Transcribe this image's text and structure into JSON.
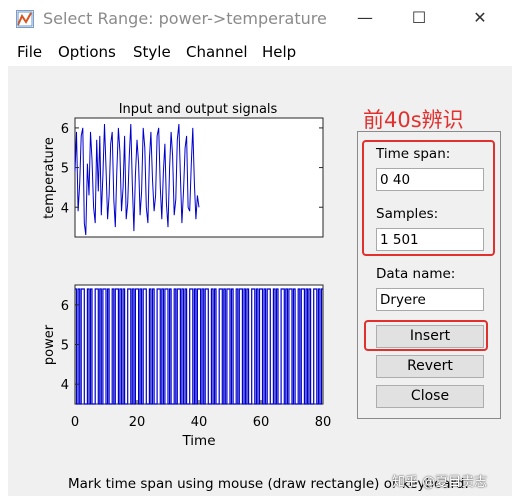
{
  "window": {
    "title": "Select Range: power->temperature",
    "minimize_glyph": "—",
    "maximize_glyph": "☐",
    "close_glyph": "✕"
  },
  "menu": [
    "File",
    "Options",
    "Style",
    "Channel",
    "Help"
  ],
  "plot": {
    "title": "Input and output signals",
    "top_ylabel": "temperature",
    "bottom_ylabel": "power",
    "xlabel": "Time",
    "top_yticks": [
      "6",
      "5",
      "4"
    ],
    "bottom_yticks": [
      "6",
      "5",
      "4"
    ],
    "xticks": [
      "0",
      "20",
      "40",
      "60",
      "80"
    ],
    "line_color": "#0000cd"
  },
  "chart_data": [
    {
      "type": "line",
      "title": "Input and output signals",
      "xlabel": "",
      "ylabel": "temperature",
      "xlim": [
        0,
        80
      ],
      "ylim": [
        3.25,
        6.25
      ],
      "series": [
        {
          "values": [
            4.9,
            5.9,
            3.9,
            4.6,
            5.8,
            6.0,
            3.6,
            3.3,
            5.1,
            4.3,
            5.9,
            5.2,
            4.0,
            3.6,
            5.7,
            4.4,
            5.8,
            3.8,
            4.8,
            6.1,
            5.0,
            3.7,
            4.3,
            5.6,
            5.9,
            4.2,
            3.5,
            4.9,
            6.0,
            5.4,
            3.9,
            4.5,
            5.8,
            3.7,
            4.1,
            5.3,
            6.1,
            4.6,
            3.4,
            4.8,
            5.7,
            5.1,
            3.8,
            4.4,
            6.0,
            5.5,
            4.0,
            3.6,
            5.2,
            5.9,
            4.7,
            3.9,
            4.3,
            5.8,
            6.0,
            4.5,
            3.7,
            4.9,
            5.6,
            4.1,
            3.5,
            5.0,
            5.9,
            5.3,
            3.8,
            4.2,
            5.7,
            6.1,
            4.8,
            3.6,
            4.4,
            5.5,
            5.8,
            4.0,
            3.9,
            5.1,
            6.0,
            4.6,
            3.7,
            4.3,
            4.0
          ]
        }
      ]
    },
    {
      "type": "line",
      "title": "",
      "xlabel": "Time",
      "ylabel": "power",
      "xlim": [
        0,
        80
      ],
      "ylim": [
        3.5,
        6.5
      ],
      "note": "pseudo-random binary signal switching between 3.5 and 6.4",
      "series": [
        {
          "values": [
            6.4,
            3.5,
            6.4,
            3.5,
            6.4,
            6.4,
            3.5,
            3.5,
            6.4,
            3.5,
            6.4,
            3.5,
            3.5,
            6.4,
            6.4,
            3.5,
            6.4,
            3.5,
            6.4,
            6.4,
            3.5,
            6.4,
            3.5,
            3.5,
            6.4,
            3.5,
            6.4,
            6.4,
            3.5,
            6.4,
            3.5,
            6.4,
            3.5,
            3.5,
            6.4,
            6.4,
            3.5,
            6.4,
            3.5,
            6.4
          ]
        }
      ]
    }
  ],
  "panel": {
    "time_span_label": "Time span:",
    "time_span_value": "0 40",
    "samples_label": "Samples:",
    "samples_value": "1 501",
    "data_name_label": "Data name:",
    "data_name_value": "Dryere",
    "insert_label": "Insert",
    "revert_label": "Revert",
    "close_label": "Close"
  },
  "annotation": {
    "text": "前40s辨识",
    "color": "#e0312f"
  },
  "status": {
    "text": "Mark time span using mouse (draw rectangle) or keyboard."
  },
  "watermark": {
    "text": "知乎 @夏目贵志"
  }
}
